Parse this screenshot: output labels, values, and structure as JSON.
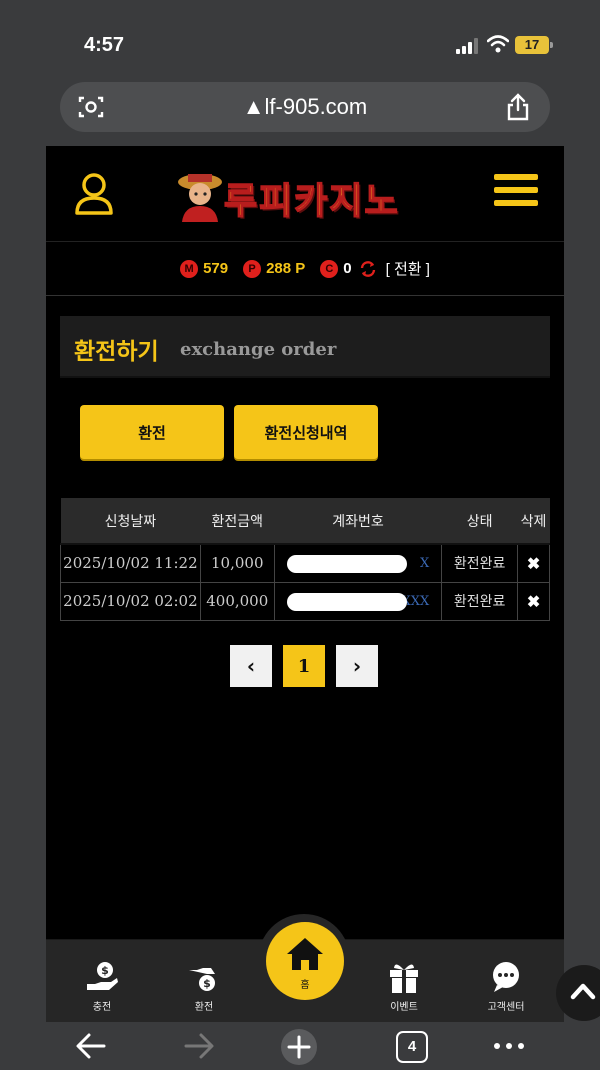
{
  "status_bar": {
    "time": "4:57",
    "battery": "17"
  },
  "browser": {
    "url": "lf-905.com"
  },
  "site": {
    "logo_text": "루피카지노"
  },
  "balance": {
    "m_badge": "M",
    "m_value": "579",
    "p_badge": "P",
    "p_value": "288 P",
    "c_badge": "C",
    "c_value": "0",
    "convert": "[ 전환 ]"
  },
  "section": {
    "title_ko": "환전하기",
    "title_en": "exchange order"
  },
  "buttons": {
    "exchange": "환전",
    "history": "환전신청내역"
  },
  "table": {
    "headers": [
      "신청날짜",
      "환전금액",
      "계좌번호",
      "상태",
      "삭제"
    ],
    "rows": [
      {
        "date": "2025/10/02 11:22",
        "amount": "10,000",
        "account": "X",
        "status": "환전완료",
        "delete": "✖"
      },
      {
        "date": "2025/10/02 02:02",
        "amount": "400,000",
        "account": "XXXXX",
        "status": "환전완료",
        "delete": "✖"
      }
    ]
  },
  "pagination": {
    "prev": "‹",
    "current": "1",
    "next": "›"
  },
  "bottom_nav": {
    "charge": "충전",
    "exchange": "환전",
    "home": "홈",
    "event": "이벤트",
    "support": "고객센터"
  },
  "toolbar": {
    "tabs": "4"
  },
  "colors": {
    "accent": "#f5c518",
    "coin": "#e0201c",
    "background": "#000000"
  }
}
